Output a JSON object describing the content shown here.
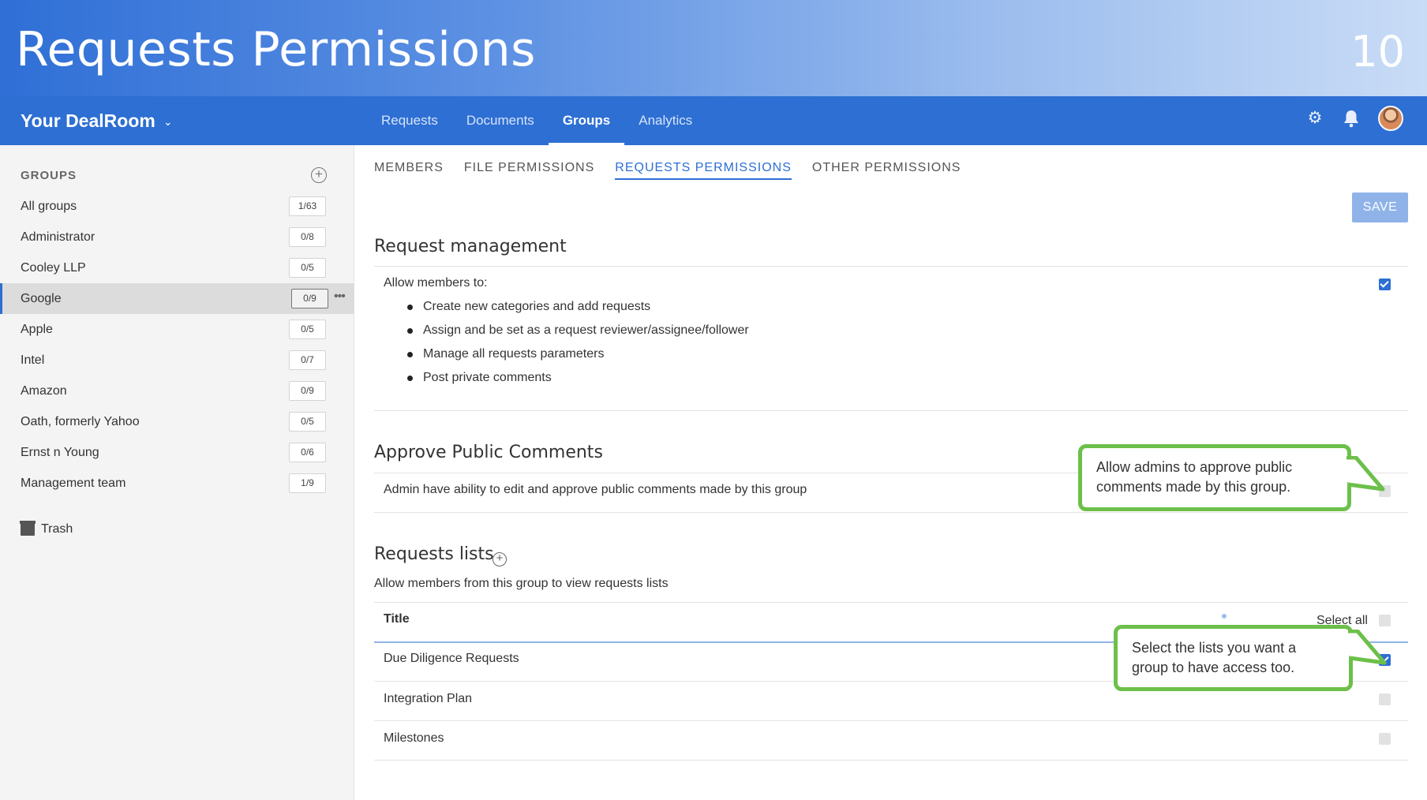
{
  "slide": {
    "title": "Requests Permissions",
    "number": "10"
  },
  "topnav": {
    "brand": "Your DealRoom",
    "tabs": [
      "Requests",
      "Documents",
      "Groups",
      "Analytics"
    ],
    "active_tab": "Groups"
  },
  "sidebar": {
    "heading": "GROUPS",
    "groups": [
      {
        "name": "All groups",
        "count": "1/63"
      },
      {
        "name": "Administrator",
        "count": "0/8"
      },
      {
        "name": "Cooley LLP",
        "count": "0/5"
      },
      {
        "name": "Google",
        "count": "0/9"
      },
      {
        "name": "Apple",
        "count": "0/5"
      },
      {
        "name": "Intel",
        "count": "0/7"
      },
      {
        "name": "Amazon",
        "count": "0/9"
      },
      {
        "name": "Oath, formerly Yahoo",
        "count": "0/5"
      },
      {
        "name": "Ernst n Young",
        "count": "0/6"
      },
      {
        "name": "Management team",
        "count": "1/9"
      }
    ],
    "active_group": "Google",
    "trash_label": "Trash"
  },
  "subtabs": [
    "MEMBERS",
    "FILE PERMISSIONS",
    "REQUESTS PERMISSIONS",
    "OTHER PERMISSIONS"
  ],
  "active_subtab": "REQUESTS PERMISSIONS",
  "save_label": "SAVE",
  "request_management": {
    "title": "Request management",
    "allow_label": "Allow members to:",
    "items": [
      "Create new categories and add requests",
      "Assign and be set as a request reviewer/assignee/follower",
      "Manage all requests parameters",
      "Post private comments"
    ],
    "checked": true
  },
  "approve_public_comments": {
    "title": "Approve Public Comments",
    "description": "Admin have ability to edit and approve public comments made by this group",
    "checked": false
  },
  "requests_lists": {
    "title": "Requests lists",
    "description": "Allow members from this group to view requests lists",
    "column_title": "Title",
    "select_all_label": "Select all",
    "rows": [
      {
        "title": "Due Diligence Requests",
        "checked": true
      },
      {
        "title": "Integration Plan",
        "checked": false
      },
      {
        "title": "Milestones",
        "checked": false
      }
    ]
  },
  "callouts": {
    "approve": "Allow admins to approve public comments made by this group.",
    "lists": "Select the lists you want a group to have access too."
  },
  "colors": {
    "brand_blue": "#2d6fd3",
    "callout_green": "#6cc04a",
    "save_button": "#8fb3e8"
  }
}
